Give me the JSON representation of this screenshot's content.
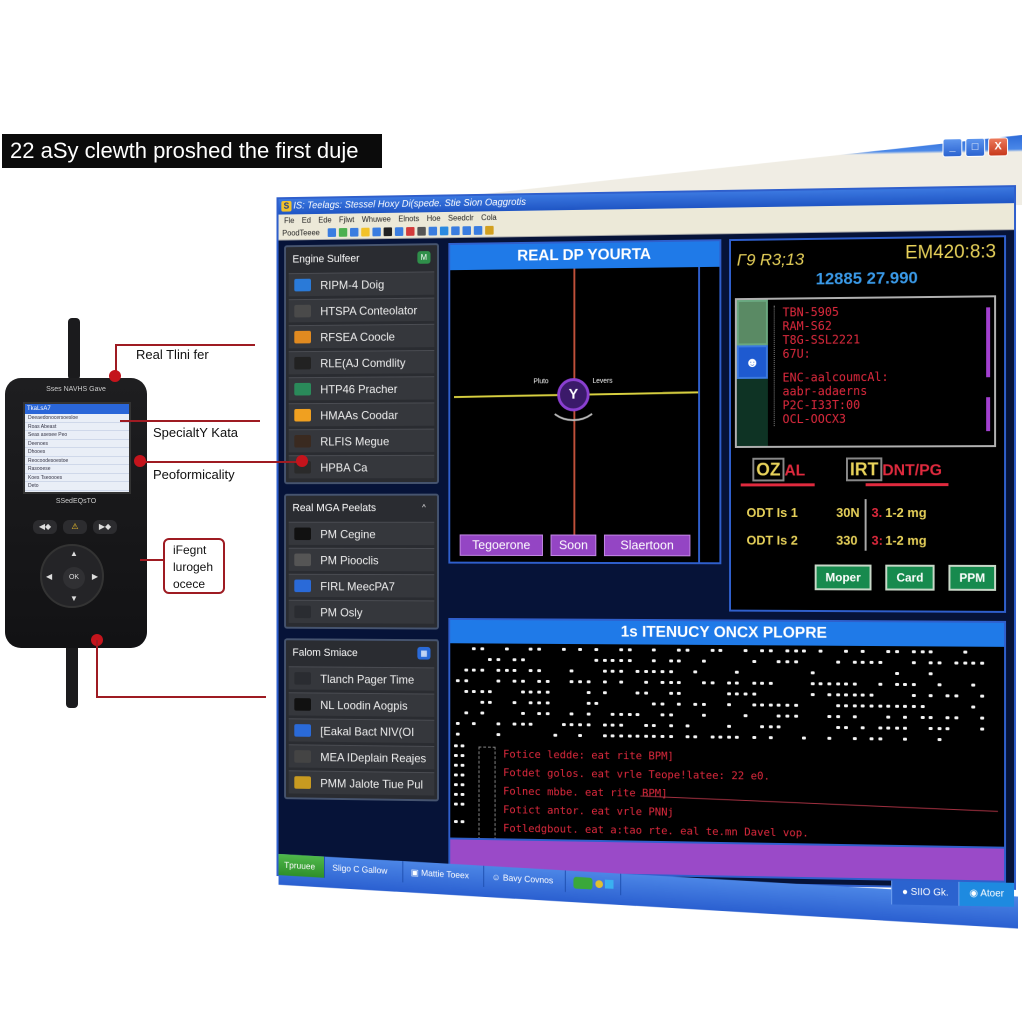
{
  "caption": "22 aSy clewth proshed the first duje",
  "window": {
    "title": "IS: Teelags: Stessel Hoxy Di(spede. Stie Sion Oaggrotis",
    "app_icon": "S",
    "controls": {
      "minimize": "_",
      "maximize": "□",
      "close": "X"
    },
    "menu": [
      "Fle",
      "Ed",
      "Ede",
      "Fjlwt",
      "Whuwee",
      "Elnots",
      "Hoe",
      "Seedclr",
      "Cola"
    ],
    "toolbar_label": "PoodTeeee",
    "toolbar_colors": [
      "#3a7de0",
      "#4caf50",
      "#3a7de0",
      "#f2c22a",
      "#3a7de0",
      "#222222",
      "#3a7de0",
      "#d23a3a",
      "#555555",
      "#3a7de0",
      "#2a8ae0",
      "#3a7de0",
      "#3a7de0",
      "#3a7de0",
      "#d2a020"
    ]
  },
  "sidebar": {
    "panels": [
      {
        "title": "Engine Sulfeer",
        "badge": "M",
        "badge_color": "#2f8f4a",
        "items": [
          {
            "label": "RIPM-4 Doig",
            "icon": "tools-icon",
            "color": "#2a7ad8"
          },
          {
            "label": "HTSPA Conteolator",
            "icon": "monitor-icon",
            "color": "#4a4a4a"
          },
          {
            "label": "RFSEA Coocle",
            "icon": "person-icon",
            "color": "#e08a20"
          },
          {
            "label": "RLE(AJ Comdlity",
            "icon": "chip-icon",
            "color": "#222222"
          },
          {
            "label": "HTP46 Pracher",
            "icon": "gauge-bar-icon",
            "color": "#2a8a5a"
          },
          {
            "label": "HMAAs Coodar",
            "icon": "folder-icon",
            "color": "#f0a020"
          },
          {
            "label": "RLFIS Megue",
            "icon": "engine-icon",
            "color": "#3a2a20"
          },
          {
            "label": "HPBA Ca",
            "icon": "car-icon",
            "color": "#2a2a2a"
          }
        ]
      },
      {
        "title": "Real MGA Peelats",
        "badge": "^",
        "badge_color": "#2a2c31",
        "items": [
          {
            "label": "PM Cegine",
            "icon": "battery-icon",
            "color": "#111111"
          },
          {
            "label": "PM Piooclis",
            "icon": "monitor-icon",
            "color": "#555555"
          },
          {
            "label": "FIRL MeecPA7",
            "icon": "satellite-icon",
            "color": "#2a6ad8"
          },
          {
            "label": "PM Osly",
            "icon": "clock-icon",
            "color": "#2a2c31"
          }
        ]
      },
      {
        "title": "Falom Smiace",
        "badge": "▦",
        "badge_color": "#2a6ad8",
        "items": [
          {
            "label": "Tlanch Pager Time",
            "icon": "wrench-icon",
            "color": "#2a2c31"
          },
          {
            "label": "NL Loodin Aogpis",
            "icon": "connector-icon",
            "color": "#111111"
          },
          {
            "label": "[Eakal Bact NIV(OI",
            "icon": "plane-icon",
            "color": "#2a6ad8"
          },
          {
            "label": "MEA IDeplain Reajes",
            "icon": "phone-icon",
            "color": "#444444"
          },
          {
            "label": "PMM Jalote Tiue Pul",
            "icon": "file-icon",
            "color": "#c89a20"
          }
        ]
      }
    ]
  },
  "scope": {
    "title": "REAL DP YOURTA",
    "knob_glyph": "Y",
    "label_left": "Pluto",
    "label_right": "Levers",
    "buttons": [
      "Tegoerone",
      "Soon",
      "Slaertoon"
    ]
  },
  "info": {
    "top_left": "Γ9 R3;13",
    "top_right": "EM420:8:3",
    "reading": "12885 27.990",
    "code_lines": [
      "TBN-5905",
      "RAM-S62",
      "T8G-SSL2221",
      "67U:",
      "",
      "ENC-aalcoumcAl:",
      "aabr-adaerns",
      "P2C-I33T:00",
      "OCL-OOCX3"
    ],
    "header_left": "OZ",
    "header_left_suffix": "AL",
    "header_right": "IRT",
    "header_right_suffix": "DNT/PG",
    "rows": [
      {
        "label": "ODT Is 1",
        "value": "30N",
        "index": "3.",
        "range": "1-2 mg"
      },
      {
        "label": "ODT Is 2",
        "value": "330",
        "index": "3:",
        "range": "1-2 mg"
      }
    ],
    "buttons": [
      "Moper",
      "Card",
      "PPM"
    ]
  },
  "log": {
    "title": "1s ITENUCY ONCX PLOPRE",
    "lines": [
      "Fotice ledde: eat rite BPM]",
      "Fotdet golos. eat vrle Teope!latee: 22 e0.",
      "Folnec mbbe. eat rite BPM]",
      "Fotict antor. eat vrle PNNj",
      "Fotledgbout. eat a:tao rte. eal te.mn Davel vop."
    ]
  },
  "taskbar": {
    "tasks": [
      "Tpruuee",
      "Sligo C Gallow",
      "Mattie Toeex",
      "Bavy Covnos"
    ],
    "tray": [
      "SIIO Gk.",
      "Atoer"
    ]
  },
  "device": {
    "brand": "Sses NAVHS Gave",
    "screen_title": "TkaLsA7",
    "screen_rows": [
      "Deeaedonocersoesloe",
      "Roas Abeast",
      "Seas asesee Peo",
      "Deenoes",
      "Dhooes",
      "Reocoodesoestoe",
      "Rasooese",
      "Koes Tseoooes"
    ],
    "screen_footer": "Deto",
    "model": "SSedEQsTO",
    "keys": [
      "◀◆",
      "⚠",
      "▶◆"
    ],
    "center_key": "OK"
  },
  "callouts": {
    "real_time": "Real Tlini fer",
    "specialty": "SpecialtY Kata",
    "performance": "Peoformicality",
    "box": [
      "iFegnt",
      "lurogeh",
      "ocece"
    ]
  }
}
